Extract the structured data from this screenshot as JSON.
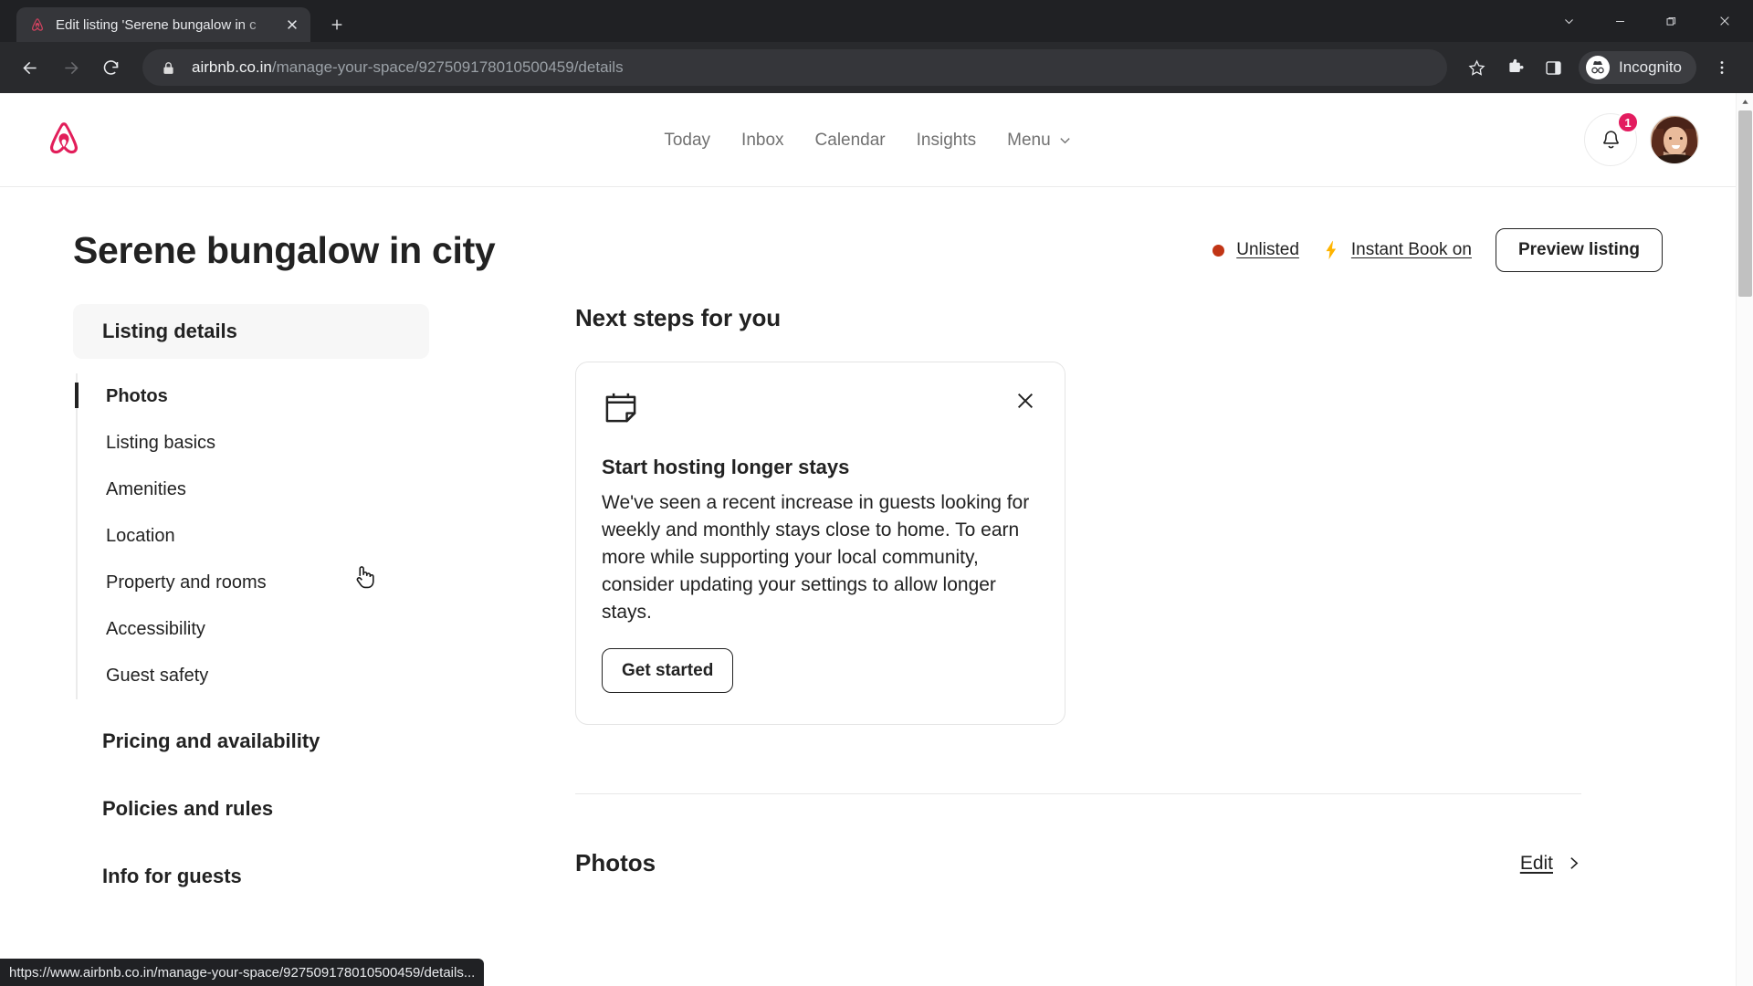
{
  "browser": {
    "tab": {
      "title": "Edit listing 'Serene bungalow in c",
      "favicon_icon": "airbnb-logo-icon",
      "close_icon": "close-icon"
    },
    "new_tab_icon": "plus-icon",
    "window_controls": [
      {
        "name": "tab-search",
        "icon": "chevron-down-icon"
      },
      {
        "name": "minimize",
        "icon": "minimize-icon"
      },
      {
        "name": "maximize",
        "icon": "restore-icon"
      },
      {
        "name": "close",
        "icon": "close-icon"
      }
    ],
    "back_icon": "arrow-left-icon",
    "forward_icon": "arrow-right-icon",
    "reload_icon": "reload-icon",
    "omnibox": {
      "lock_icon": "lock-icon",
      "domain": "airbnb.co.in",
      "path": "/manage-your-space/927509178010500459/details"
    },
    "toolbar_icons": [
      {
        "name": "bookmark-star-icon"
      },
      {
        "name": "extensions-puzzle-icon"
      },
      {
        "name": "side-panel-icon"
      }
    ],
    "incognito": {
      "label": "Incognito",
      "icon": "incognito-icon"
    },
    "menu_icon": "kebab-menu-icon",
    "status_bubble": "https://www.airbnb.co.in/manage-your-space/927509178010500459/details..."
  },
  "header": {
    "logo_icon": "airbnb-belo-logo-icon",
    "brand_color": "#E21E5A",
    "nav": [
      {
        "label": "Today"
      },
      {
        "label": "Inbox"
      },
      {
        "label": "Calendar"
      },
      {
        "label": "Insights"
      },
      {
        "label": "Menu",
        "has_chevron": true
      }
    ],
    "notifications": {
      "icon": "bell-icon",
      "count": "1",
      "badge_color": "#E31C5F"
    },
    "avatar": {
      "name": "user-avatar"
    }
  },
  "listing": {
    "title": "Serene bungalow in city",
    "status": {
      "label": "Unlisted",
      "dot_color": "#C13515"
    },
    "instant_book": {
      "label": "Instant Book on",
      "icon": "lightning-bolt-icon"
    },
    "preview_button": "Preview listing"
  },
  "sidebar": {
    "sections": [
      {
        "label": "Listing details",
        "active": true
      },
      {
        "label": "Pricing and availability",
        "active": false
      },
      {
        "label": "Policies and rules",
        "active": false
      },
      {
        "label": "Info for guests",
        "active": false
      }
    ],
    "items": [
      {
        "label": "Photos",
        "active": true
      },
      {
        "label": "Listing basics",
        "active": false
      },
      {
        "label": "Amenities",
        "active": false
      },
      {
        "label": "Location",
        "active": false
      },
      {
        "label": "Property and rooms",
        "active": false
      },
      {
        "label": "Accessibility",
        "active": false
      },
      {
        "label": "Guest safety",
        "active": false
      }
    ]
  },
  "main": {
    "next_steps_heading": "Next steps for you",
    "card": {
      "icon": "calendar-note-icon",
      "close_icon": "close-icon",
      "title": "Start hosting longer stays",
      "body": "We've seen a recent increase in guests looking for weekly and monthly stays close to home. To earn more while supporting your local community, consider updating your settings to allow longer stays.",
      "cta": "Get started"
    },
    "photos_section": {
      "heading": "Photos",
      "edit_label": "Edit",
      "chevron_icon": "chevron-right-icon"
    }
  }
}
